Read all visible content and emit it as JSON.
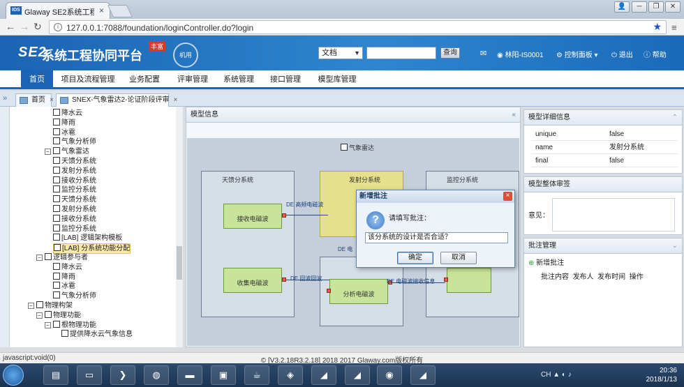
{
  "browser": {
    "tab_title": "Glaway SE2系统工程协",
    "tab_icon": "IDS",
    "url": "127.0.0.1:7088/foundation/loginController.do?login"
  },
  "header": {
    "logo": "SE2",
    "app_title": "系统工程协同平台",
    "red_tag": "丰富",
    "seal_text": "机用",
    "doc_select": "文档",
    "search_placeholder": "",
    "search_button": "查询",
    "user": "林阳-IS0001",
    "control_panel": "控制面板",
    "logout": "退出",
    "help": "帮助"
  },
  "nav": [
    "首页",
    "项目及流程管理",
    "业务配置",
    "评审管理",
    "系统管理",
    "接口管理",
    "模型库管理"
  ],
  "page_tabs": [
    {
      "label": "首页"
    },
    {
      "label": "SNEX-气象雷达2-论证阶段评审"
    }
  ],
  "tree": [
    {
      "label": "降水云",
      "indent": 0
    },
    {
      "label": "降雨",
      "indent": 0
    },
    {
      "label": "冰雹",
      "indent": 0
    },
    {
      "label": "气象分析师",
      "indent": 0
    },
    {
      "label": "气象雷达",
      "indent": -1,
      "expander": "⊟"
    },
    {
      "label": "天馈分系统",
      "indent": 0
    },
    {
      "label": "发射分系统",
      "indent": 0
    },
    {
      "label": "接收分系统",
      "indent": 0
    },
    {
      "label": "监控分系统",
      "indent": 0
    },
    {
      "label": "天馈分系统",
      "indent": 0
    },
    {
      "label": "发射分系统",
      "indent": 0
    },
    {
      "label": "接收分系统",
      "indent": 0
    },
    {
      "label": "监控分系统",
      "indent": 0
    },
    {
      "label": "[LAB] 逻辑架构模板",
      "indent": 0
    },
    {
      "label": "[LAB] 分系统功能分配",
      "indent": 0,
      "selected": true
    },
    {
      "label": "逻辑参与者",
      "indent": -2,
      "expander": "⊟"
    },
    {
      "label": "降水云",
      "indent": 0
    },
    {
      "label": "降雨",
      "indent": 0
    },
    {
      "label": "冰雹",
      "indent": 0
    },
    {
      "label": "气象分析师",
      "indent": 0
    },
    {
      "label": "物理构架",
      "indent": -3,
      "expander": "⊟"
    },
    {
      "label": "物理功能",
      "indent": -2,
      "expander": "⊟"
    },
    {
      "label": "根物理功能",
      "indent": -1,
      "expander": "⊟"
    },
    {
      "label": "提供降水云气象信息",
      "indent": 1
    }
  ],
  "center": {
    "title": "模型信息",
    "root_label": "气象雷达",
    "systems": [
      "天馈分系统",
      "发射分系统",
      "监控分系统"
    ],
    "functions": [
      "接收电磁波",
      "收集电磁波",
      "分析电磁波"
    ],
    "flows": [
      "DE 高频电磁波",
      "DE 回波回波",
      "DE 电磁波接收信息",
      "DE 电"
    ]
  },
  "right": {
    "detail_title": "模型详细信息",
    "props": [
      {
        "k": "unique",
        "v": "false"
      },
      {
        "k": "name",
        "v": "发射分系统"
      },
      {
        "k": "final",
        "v": "false"
      }
    ],
    "overall_title": "模型整体审签",
    "opinion_label": "意见：",
    "annot_title": "批注管理",
    "add_annot": "新增批注",
    "annot_cols": [
      "批注内容",
      "发布人",
      "发布时间",
      "操作"
    ]
  },
  "dialog": {
    "title": "新增批注",
    "prompt": "请填写批注：",
    "value": "该分系统的设计是否合适？",
    "ok": "确定",
    "cancel": "取消"
  },
  "footer": {
    "status": "javascript:void(0)",
    "copyright": "© [V3.2.18R3.2.18] 2018 2017 Glaway.com版权所有"
  },
  "taskbar": {
    "time": "20:36",
    "date": "2018/1/13",
    "tray": "CH"
  },
  "colors": {
    "accent": "#1b64b3",
    "function_box": "#c8e39a",
    "selected_system": "#e6e08a"
  }
}
